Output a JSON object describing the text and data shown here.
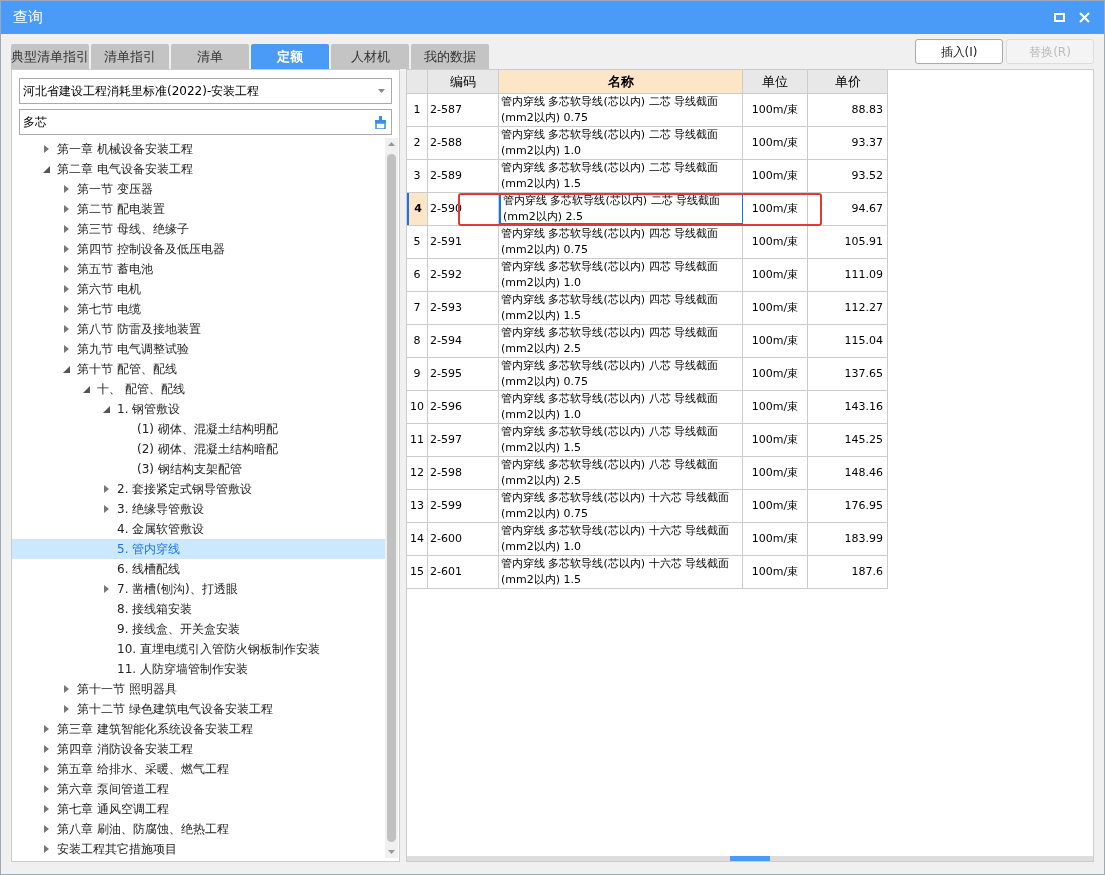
{
  "window": {
    "title": "查询"
  },
  "tabs": [
    {
      "label": "典型清单指引",
      "selected": false
    },
    {
      "label": "清单指引",
      "selected": false
    },
    {
      "label": "清单",
      "selected": false
    },
    {
      "label": "定额",
      "selected": true
    },
    {
      "label": "人材机",
      "selected": false
    },
    {
      "label": "我的数据",
      "selected": false
    }
  ],
  "buttons": [
    {
      "label": "插入(I)",
      "disabled": false
    },
    {
      "label": "替换(R)",
      "disabled": true
    }
  ],
  "library_select": {
    "value": "河北省建设工程消耗里标准(2022)-安装工程"
  },
  "search": {
    "value": "多芯"
  },
  "tree": [
    {
      "label": "第一章 机械设备安装工程",
      "kind": "branch",
      "expanded": false,
      "selected": false
    },
    {
      "label": "第二章 电气设备安装工程",
      "kind": "branch",
      "expanded": true,
      "selected": false,
      "children": [
        {
          "label": "第一节 变压器",
          "kind": "branch",
          "expanded": false,
          "selected": false
        },
        {
          "label": "第二节 配电装置",
          "kind": "branch",
          "expanded": false,
          "selected": false
        },
        {
          "label": "第三节 母线、绝缘子",
          "kind": "branch",
          "expanded": false,
          "selected": false
        },
        {
          "label": "第四节 控制设备及低压电器",
          "kind": "branch",
          "expanded": false,
          "selected": false
        },
        {
          "label": "第五节 蓄电池",
          "kind": "branch",
          "expanded": false,
          "selected": false
        },
        {
          "label": "第六节 电机",
          "kind": "branch",
          "expanded": false,
          "selected": false
        },
        {
          "label": "第七节 电缆",
          "kind": "branch",
          "expanded": false,
          "selected": false
        },
        {
          "label": "第八节 防雷及接地装置",
          "kind": "branch",
          "expanded": false,
          "selected": false
        },
        {
          "label": "第九节 电气调整试验",
          "kind": "branch",
          "expanded": false,
          "selected": false
        },
        {
          "label": "第十节 配管、配线",
          "kind": "branch",
          "expanded": true,
          "selected": false,
          "children": [
            {
              "label": "十、 配管、配线",
              "kind": "branch",
              "expanded": true,
              "selected": false,
              "children": [
                {
                  "label": "1. 钢管敷设",
                  "kind": "branch",
                  "expanded": true,
                  "selected": false,
                  "children": [
                    {
                      "label": "(1) 砌体、混凝土结构明配",
                      "kind": "leaf",
                      "selected": false
                    },
                    {
                      "label": "(2) 砌体、混凝土结构暗配",
                      "kind": "leaf",
                      "selected": false
                    },
                    {
                      "label": "(3) 钢结构支架配管",
                      "kind": "leaf",
                      "selected": false
                    }
                  ]
                },
                {
                  "label": "2. 套接紧定式钢导管敷设",
                  "kind": "branch",
                  "expanded": false,
                  "selected": false
                },
                {
                  "label": "3. 绝缘导管敷设",
                  "kind": "branch",
                  "expanded": false,
                  "selected": false
                },
                {
                  "label": "4. 金属软管敷设",
                  "kind": "leaf",
                  "selected": false
                },
                {
                  "label": "5. 管内穿线",
                  "kind": "leaf",
                  "selected": true
                },
                {
                  "label": "6. 线槽配线",
                  "kind": "leaf",
                  "selected": false
                },
                {
                  "label": "7. 凿槽(刨沟)、打透眼",
                  "kind": "branch",
                  "expanded": false,
                  "selected": false
                },
                {
                  "label": "8. 接线箱安装",
                  "kind": "leaf",
                  "selected": false
                },
                {
                  "label": "9. 接线盒、开关盒安装",
                  "kind": "leaf",
                  "selected": false
                },
                {
                  "label": "10. 直埋电缆引入管防火钢板制作安装",
                  "kind": "leaf",
                  "selected": false
                },
                {
                  "label": "11. 人防穿墙管制作安装",
                  "kind": "leaf",
                  "selected": false
                }
              ]
            }
          ]
        },
        {
          "label": "第十一节 照明器具",
          "kind": "branch",
          "expanded": false,
          "selected": false
        },
        {
          "label": "第十二节 绿色建筑电气设备安装工程",
          "kind": "branch",
          "expanded": false,
          "selected": false
        }
      ]
    },
    {
      "label": "第三章 建筑智能化系统设备安装工程",
      "kind": "branch",
      "expanded": false,
      "selected": false
    },
    {
      "label": "第四章 消防设备安装工程",
      "kind": "branch",
      "expanded": false,
      "selected": false
    },
    {
      "label": "第五章 给排水、采暖、燃气工程",
      "kind": "branch",
      "expanded": false,
      "selected": false
    },
    {
      "label": "第六章 泵间管道工程",
      "kind": "branch",
      "expanded": false,
      "selected": false
    },
    {
      "label": "第七章 通风空调工程",
      "kind": "branch",
      "expanded": false,
      "selected": false
    },
    {
      "label": "第八章 刷油、防腐蚀、绝热工程",
      "kind": "branch",
      "expanded": false,
      "selected": false
    },
    {
      "label": "安装工程其它措施项目",
      "kind": "branch",
      "expanded": false,
      "selected": false
    }
  ],
  "table": {
    "columns": [
      {
        "label": "编码",
        "selected": false
      },
      {
        "label": "名称",
        "selected": true
      },
      {
        "label": "单位",
        "selected": false
      },
      {
        "label": "单价",
        "selected": false
      }
    ],
    "rows": [
      {
        "index": "1",
        "code": "2-587",
        "name": "管内穿线 多芯软导线(芯以内) 二芯 导线截面(mm2以内) 0.75",
        "unit": "100m/束",
        "price": "88.83",
        "selected": false
      },
      {
        "index": "2",
        "code": "2-588",
        "name": "管内穿线 多芯软导线(芯以内) 二芯 导线截面(mm2以内) 1.0",
        "unit": "100m/束",
        "price": "93.37",
        "selected": false
      },
      {
        "index": "3",
        "code": "2-589",
        "name": "管内穿线 多芯软导线(芯以内) 二芯 导线截面(mm2以内) 1.5",
        "unit": "100m/束",
        "price": "93.52",
        "selected": false
      },
      {
        "index": "4",
        "code": "2-590",
        "name": "管内穿线 多芯软导线(芯以内) 二芯 导线截面(mm2以内) 2.5",
        "unit": "100m/束",
        "price": "94.67",
        "selected": true
      },
      {
        "index": "5",
        "code": "2-591",
        "name": "管内穿线 多芯软导线(芯以内) 四芯 导线截面(mm2以内) 0.75",
        "unit": "100m/束",
        "price": "105.91",
        "selected": false
      },
      {
        "index": "6",
        "code": "2-592",
        "name": "管内穿线 多芯软导线(芯以内) 四芯 导线截面(mm2以内) 1.0",
        "unit": "100m/束",
        "price": "111.09",
        "selected": false
      },
      {
        "index": "7",
        "code": "2-593",
        "name": "管内穿线 多芯软导线(芯以内) 四芯 导线截面(mm2以内) 1.5",
        "unit": "100m/束",
        "price": "112.27",
        "selected": false
      },
      {
        "index": "8",
        "code": "2-594",
        "name": "管内穿线 多芯软导线(芯以内) 四芯 导线截面(mm2以内) 2.5",
        "unit": "100m/束",
        "price": "115.04",
        "selected": false
      },
      {
        "index": "9",
        "code": "2-595",
        "name": "管内穿线 多芯软导线(芯以内) 八芯 导线截面(mm2以内) 0.75",
        "unit": "100m/束",
        "price": "137.65",
        "selected": false
      },
      {
        "index": "10",
        "code": "2-596",
        "name": "管内穿线 多芯软导线(芯以内) 八芯 导线截面(mm2以内) 1.0",
        "unit": "100m/束",
        "price": "143.16",
        "selected": false
      },
      {
        "index": "11",
        "code": "2-597",
        "name": "管内穿线 多芯软导线(芯以内) 八芯 导线截面(mm2以内) 1.5",
        "unit": "100m/束",
        "price": "145.25",
        "selected": false
      },
      {
        "index": "12",
        "code": "2-598",
        "name": "管内穿线 多芯软导线(芯以内) 八芯 导线截面(mm2以内) 2.5",
        "unit": "100m/束",
        "price": "148.46",
        "selected": false
      },
      {
        "index": "13",
        "code": "2-599",
        "name": "管内穿线 多芯软导线(芯以内) 十六芯 导线截面(mm2以内) 0.75",
        "unit": "100m/束",
        "price": "176.95",
        "selected": false
      },
      {
        "index": "14",
        "code": "2-600",
        "name": "管内穿线 多芯软导线(芯以内) 十六芯 导线截面(mm2以内) 1.0",
        "unit": "100m/束",
        "price": "183.99",
        "selected": false
      },
      {
        "index": "15",
        "code": "2-601",
        "name": "管内穿线 多芯软导线(芯以内) 十六芯 导线截面(mm2以内) 1.5",
        "unit": "100m/束",
        "price": "187.6",
        "selected": false
      }
    ]
  }
}
